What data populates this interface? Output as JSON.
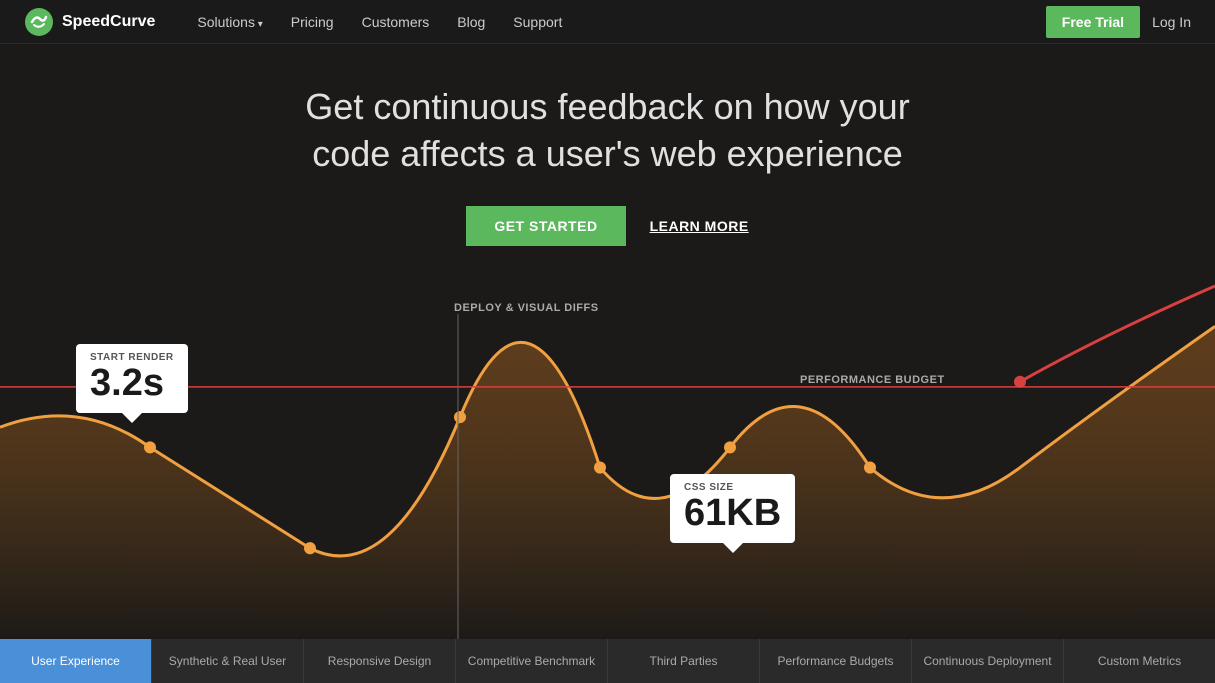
{
  "nav": {
    "logo_text": "SpeedCurve",
    "links": [
      {
        "label": "Solutions",
        "has_arrow": true
      },
      {
        "label": "Pricing",
        "has_arrow": false
      },
      {
        "label": "Customers",
        "has_arrow": false
      },
      {
        "label": "Blog",
        "has_arrow": false
      },
      {
        "label": "Support",
        "has_arrow": false
      }
    ],
    "free_trial_label": "Free Trial",
    "login_label": "Log In"
  },
  "hero": {
    "headline": "Get continuous feedback on how your code affects a user's web experience",
    "get_started_label": "GET STARTED",
    "learn_more_label": "LEARN MORE"
  },
  "annotations": {
    "deploy_label": "DEPLOY & VISUAL DIFFS",
    "budget_label": "PERFORMANCE BUDGET"
  },
  "tooltips": {
    "start_render": {
      "label": "START RENDER",
      "value": "3.2s"
    },
    "css_size": {
      "label": "CSS SIZE",
      "value": "61KB"
    }
  },
  "tabs": [
    {
      "label": "User Experience",
      "active": true
    },
    {
      "label": "Synthetic & Real User",
      "active": false
    },
    {
      "label": "Responsive Design",
      "active": false
    },
    {
      "label": "Competitive Benchmark",
      "active": false
    },
    {
      "label": "Third Parties",
      "active": false
    },
    {
      "label": "Performance Budgets",
      "active": false
    },
    {
      "label": "Continuous Deployment",
      "active": false
    },
    {
      "label": "Custom Metrics",
      "active": false
    }
  ],
  "colors": {
    "accent_green": "#5cb85c",
    "nav_bg": "#1a1a1a",
    "hero_bg": "#1c1a18",
    "line_orange": "#f0a040",
    "line_red": "#d94040",
    "budget_line": "#d94040",
    "tab_active": "#4a90d9"
  }
}
